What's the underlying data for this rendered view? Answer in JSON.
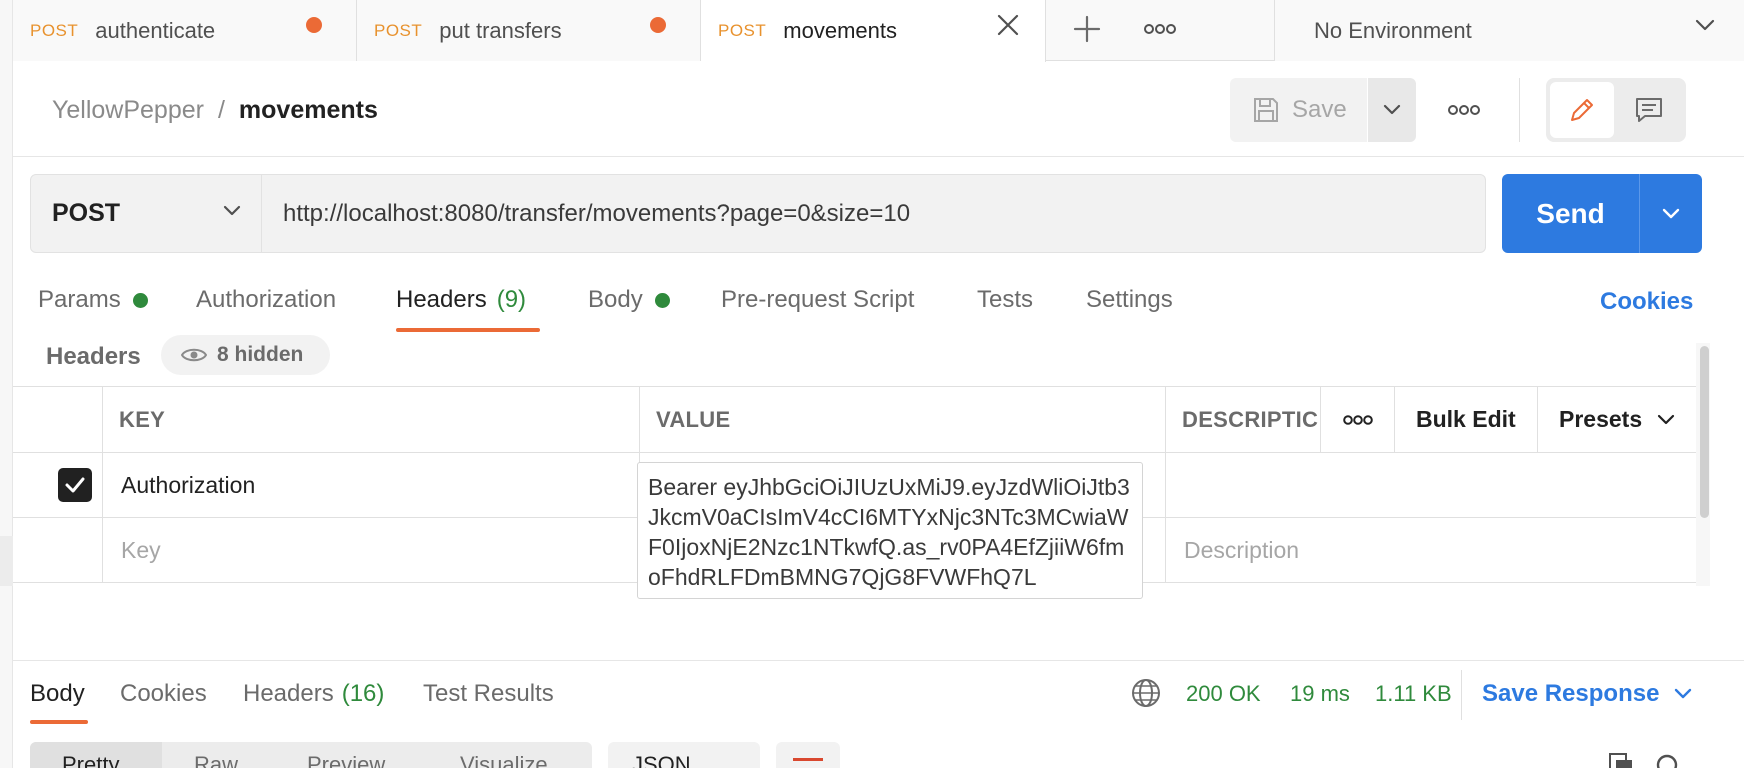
{
  "tabs": [
    {
      "method": "POST",
      "name": "authenticate",
      "unsaved": true
    },
    {
      "method": "POST",
      "name": "put transfers",
      "unsaved": true
    },
    {
      "method": "POST",
      "name": "movements",
      "active": true
    }
  ],
  "environment": {
    "selected": "No Environment"
  },
  "breadcrumb": {
    "workspace": "YellowPepper",
    "separator": "/",
    "current": "movements"
  },
  "toolbar": {
    "save_label": "Save"
  },
  "request": {
    "method": "POST",
    "url": "http://localhost:8080/transfer/movements?page=0&size=10",
    "send_label": "Send"
  },
  "request_tabs": [
    {
      "label": "Params",
      "dot": true
    },
    {
      "label": "Authorization"
    },
    {
      "label": "Headers",
      "count": "(9)",
      "active": true
    },
    {
      "label": "Body",
      "dot": true
    },
    {
      "label": "Pre-request Script"
    },
    {
      "label": "Tests"
    },
    {
      "label": "Settings"
    }
  ],
  "cookies_label": "Cookies",
  "headers_section": {
    "title": "Headers",
    "hidden_label": "8 hidden"
  },
  "table": {
    "columns": {
      "key": "KEY",
      "value": "VALUE",
      "description": "DESCRIPTIC",
      "bulk_edit": "Bulk Edit",
      "presets": "Presets"
    },
    "rows": [
      {
        "checked": true,
        "key": "Authorization",
        "value": "Bearer eyJhbGciOiJIUzUxMiJ9.eyJzdWliOiJtb3JkcmV0aCIsImV4cCI6MTYxNjc3NTc3MCwiaWF0IjoxNjE2Nzc1NTkwfQ.as_rv0PA4EfZjiiW6fmoFhdRLFDmBMNG7QjG8FVWFhQ7L"
      }
    ],
    "placeholders": {
      "key": "Key",
      "description": "Description"
    }
  },
  "response": {
    "tabs": [
      {
        "label": "Body",
        "active": true
      },
      {
        "label": "Cookies"
      },
      {
        "label": "Headers",
        "count": "(16)"
      },
      {
        "label": "Test Results"
      }
    ],
    "status": "200 OK",
    "time": "19 ms",
    "size": "1.11 KB",
    "save_label": "Save Response",
    "formats": [
      "Pretty",
      "Raw",
      "Preview",
      "Visualize"
    ],
    "language": "JSON"
  },
  "colors": {
    "accent_orange": "#eb6a36",
    "method_orange": "#e8922e",
    "send_blue": "#2d7ae0",
    "success_green": "#2f8a3c"
  }
}
